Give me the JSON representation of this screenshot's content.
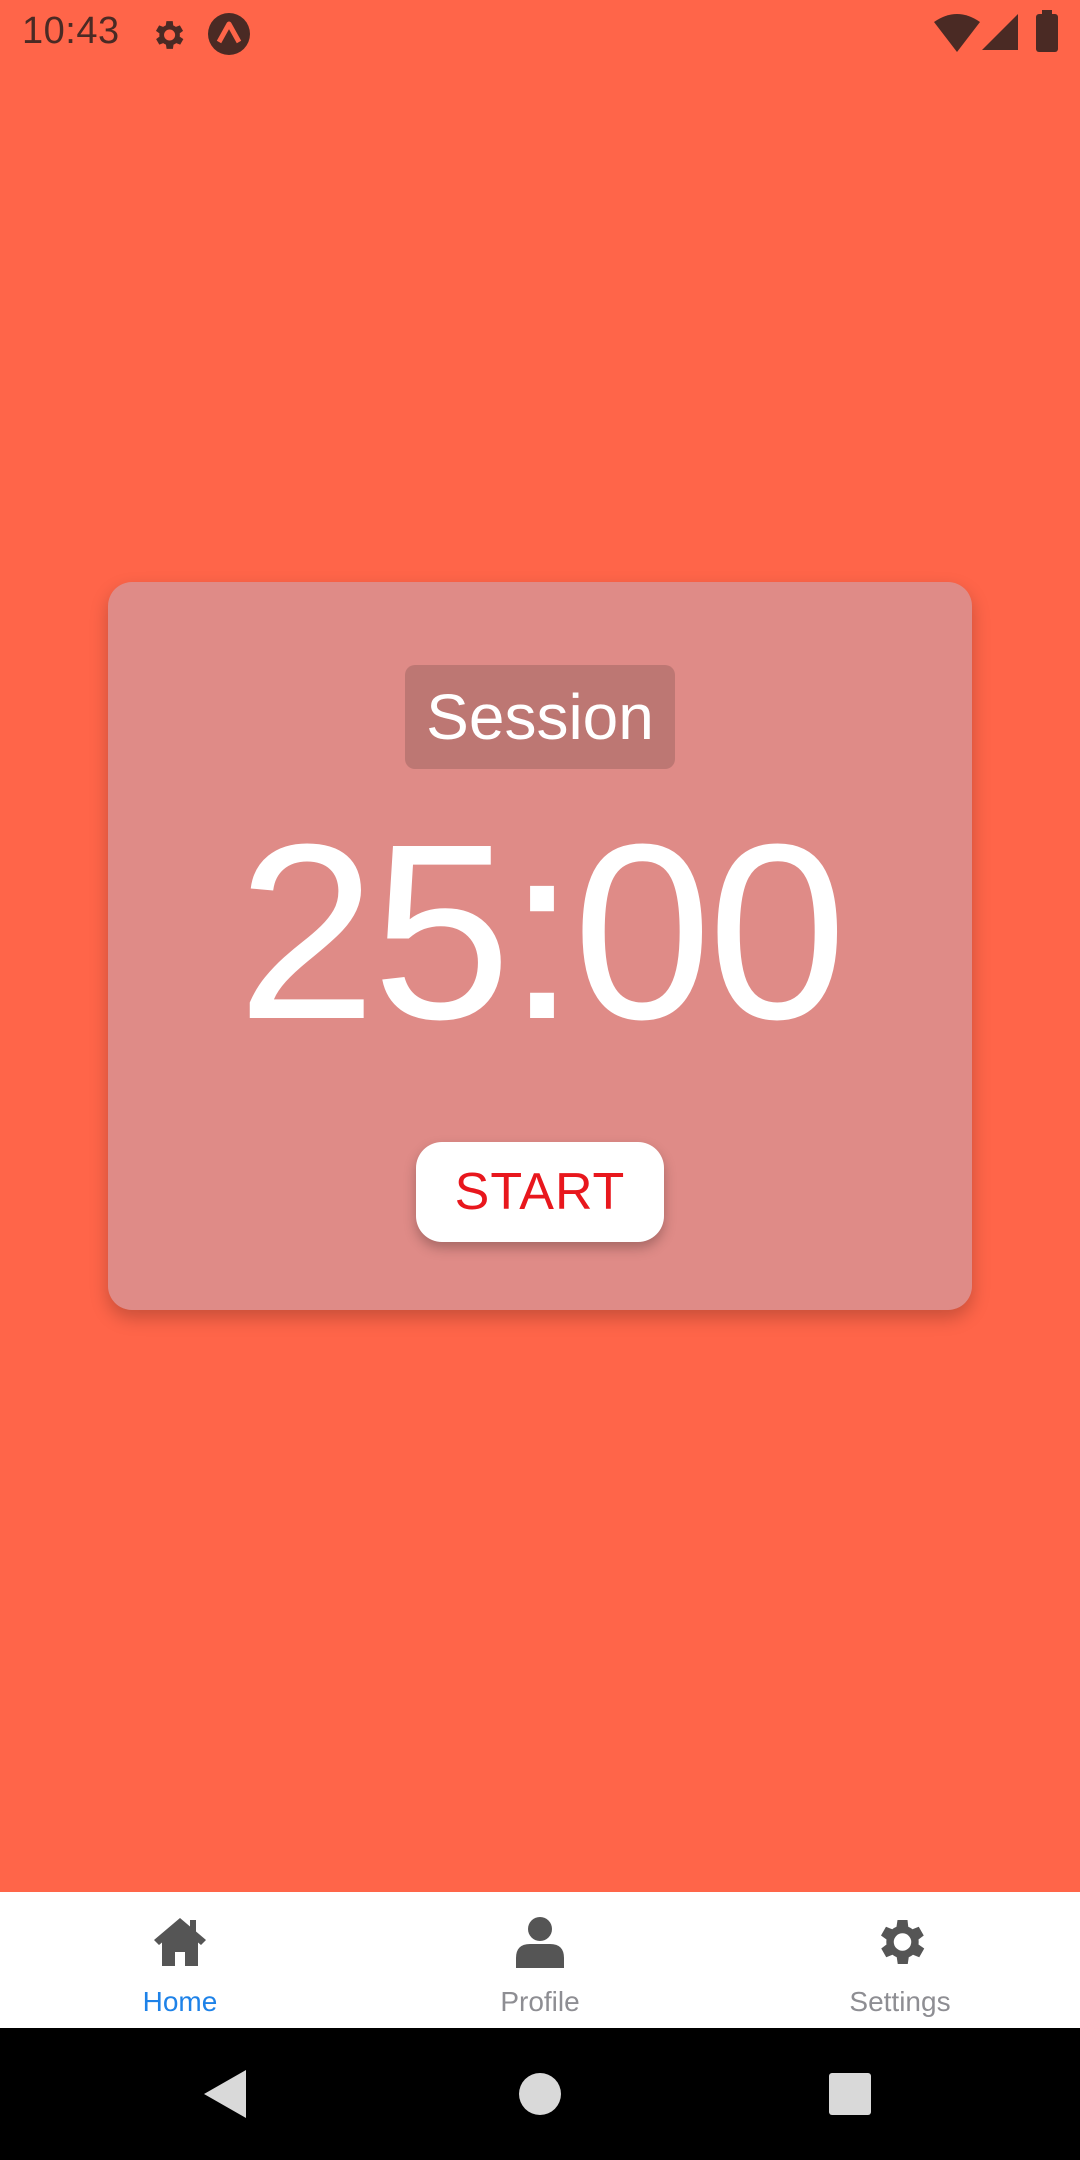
{
  "status_bar": {
    "time": "10:43",
    "left_icons": [
      "gear-icon",
      "expo-icon"
    ],
    "right_icons": [
      "wifi-icon",
      "cell-signal-icon",
      "battery-icon"
    ]
  },
  "timer": {
    "mode_label": "Session",
    "time_display": "25:00",
    "start_label": "START"
  },
  "tabs": [
    {
      "label": "Home",
      "icon": "home-icon",
      "active": true
    },
    {
      "label": "Profile",
      "icon": "person-icon",
      "active": false
    },
    {
      "label": "Settings",
      "icon": "gear-icon",
      "active": false
    }
  ],
  "nav_bar": [
    "back-triangle-icon",
    "home-circle-icon",
    "recents-square-icon"
  ],
  "colors": {
    "background": "#FF6549",
    "card": "#DF8B87",
    "badge": "#BD7773",
    "start_text": "#E8171D",
    "tab_active": "#1E82E8",
    "tab_inactive": "#8e8e93"
  }
}
